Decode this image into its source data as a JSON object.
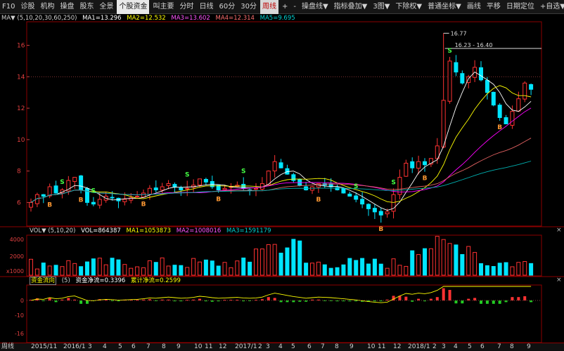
{
  "toolbar": [
    {
      "label": "F10",
      "active": false
    },
    {
      "label": "诊股",
      "active": false
    },
    {
      "label": "机构",
      "active": false
    },
    {
      "label": "操盘",
      "active": false
    },
    {
      "label": "股东",
      "active": false
    },
    {
      "label": "全景",
      "active": false
    },
    {
      "label": "个股资金",
      "active": true
    },
    {
      "label": "叫主要",
      "active": false
    },
    {
      "label": "分时",
      "active": false
    },
    {
      "label": "日线",
      "active": false
    },
    {
      "label": "60分",
      "active": false
    },
    {
      "label": "30分",
      "active": false
    },
    {
      "label": "周线",
      "active": true
    },
    {
      "label": "+",
      "active": false
    },
    {
      "label": "-",
      "active": false
    },
    {
      "label": "操盘线▼",
      "active": false
    },
    {
      "label": "指标叠加▼",
      "active": false
    },
    {
      "label": "3图▼",
      "active": false
    },
    {
      "label": "下除权▼",
      "active": false
    },
    {
      "label": "普通坐标▼",
      "active": false
    },
    {
      "label": "画线",
      "active": false
    },
    {
      "label": "平移",
      "active": false
    },
    {
      "label": "日期定位",
      "active": false
    },
    {
      "label": "+自选▼",
      "active": false
    }
  ],
  "main_indicator": {
    "name": "MA▼ (5,10,20,30,60,250)",
    "ma1": "MA1=13.296",
    "ma2": "MA2=12.532",
    "ma3": "MA3=13.602",
    "ma4": "MA4=12.314",
    "ma5": "MA5=9.695"
  },
  "price_axis": [
    "16",
    "14",
    "12",
    "10",
    "8",
    "6"
  ],
  "annotations": {
    "high": "16.77",
    "range": "16.23 - 16.40"
  },
  "signals": {
    "sell": "S",
    "buy": "B"
  },
  "volume_indicator": {
    "name": "VOL▼ (5,10,20)",
    "vol": "VOL=864387",
    "ma1": "MA1=1053873",
    "ma2": "MA2=1008016",
    "ma3": "MA3=1591179"
  },
  "volume_axis": [
    "4000",
    "2000",
    "x1000"
  ],
  "flow_indicator": {
    "name": "资金流向",
    "period": "(5)",
    "net": "资金净流=0.3396",
    "cum": "累计净流=0.2599"
  },
  "flow_axis": [
    "0",
    "-10",
    "-16"
  ],
  "close_label": "×",
  "dates": [
    {
      "t": "周线",
      "x": 2
    },
    {
      "t": "2015/11",
      "x": 44
    },
    {
      "t": "2016/1",
      "x": 90
    },
    {
      "t": "3",
      "x": 125
    },
    {
      "t": "4",
      "x": 146
    },
    {
      "t": "5",
      "x": 168
    },
    {
      "t": "6",
      "x": 187
    },
    {
      "t": "7",
      "x": 208
    },
    {
      "t": "8",
      "x": 230
    },
    {
      "t": "9",
      "x": 251
    },
    {
      "t": "10",
      "x": 276
    },
    {
      "t": "11",
      "x": 291
    },
    {
      "t": "12",
      "x": 311
    },
    {
      "t": "2017/1",
      "x": 334
    },
    {
      "t": "2",
      "x": 367
    },
    {
      "t": "3",
      "x": 378
    },
    {
      "t": "4",
      "x": 396
    },
    {
      "t": "5",
      "x": 414
    },
    {
      "t": "6",
      "x": 437
    },
    {
      "t": "7",
      "x": 456
    },
    {
      "t": "8",
      "x": 476
    },
    {
      "t": "9",
      "x": 497
    },
    {
      "t": "10",
      "x": 522
    },
    {
      "t": "11",
      "x": 537
    },
    {
      "t": "12",
      "x": 559
    },
    {
      "t": "2018/1",
      "x": 580
    },
    {
      "t": "2",
      "x": 615
    },
    {
      "t": "3",
      "x": 628
    },
    {
      "t": "4",
      "x": 645
    },
    {
      "t": "5",
      "x": 665
    },
    {
      "t": "6",
      "x": 683
    },
    {
      "t": "7",
      "x": 707
    },
    {
      "t": "8",
      "x": 725
    },
    {
      "t": "9",
      "x": 749
    }
  ],
  "colors": {
    "up": "#ff3232",
    "down": "#00e5ff",
    "ma1": "#ffffff",
    "ma2": "#ffff00",
    "ma3": "#ff00ff",
    "ma4": "#e06060",
    "ma5": "#00b0b0",
    "grid": "#8b0000"
  },
  "chart_data": [
    {
      "type": "candlestick",
      "title": "",
      "x": "weeks (2015/11 - 2018/9)",
      "ylim": [
        4.5,
        17.5
      ],
      "closes": [
        6.0,
        6.5,
        6.4,
        7.0,
        6.6,
        6.8,
        7.4,
        7.6,
        6.8,
        6.0,
        5.9,
        6.2,
        6.4,
        6.3,
        6.1,
        6.2,
        6.3,
        6.4,
        6.6,
        6.9,
        6.8,
        7.0,
        7.2,
        7.0,
        6.8,
        6.9,
        7.1,
        7.5,
        7.3,
        7.0,
        6.8,
        6.9,
        7.0,
        7.1,
        6.9,
        6.8,
        6.9,
        7.2,
        8.0,
        8.6,
        8.2,
        7.8,
        7.4,
        7.1,
        6.8,
        7.0,
        7.2,
        7.1,
        7.0,
        6.8,
        6.6,
        6.4,
        6.2,
        5.9,
        5.6,
        5.4,
        5.2,
        5.4,
        6.5,
        7.6,
        8.5,
        8.2,
        8.6,
        8.4,
        8.8,
        9.6,
        12.5,
        15.0,
        14.3,
        13.6,
        14.0,
        14.6,
        13.8,
        13.0,
        12.2,
        11.4,
        11.0,
        11.8,
        12.6,
        13.6,
        13.2
      ],
      "ma5_line": "white",
      "ma10_line": "yellow",
      "ma20_line": "magenta",
      "ma30_line": "red",
      "ma60_line": "teal"
    },
    {
      "type": "bar",
      "title": "VOL",
      "ylim": [
        0,
        5000
      ]
    },
    {
      "type": "bar",
      "title": "资金流向",
      "ylim": [
        -16,
        2
      ]
    }
  ]
}
